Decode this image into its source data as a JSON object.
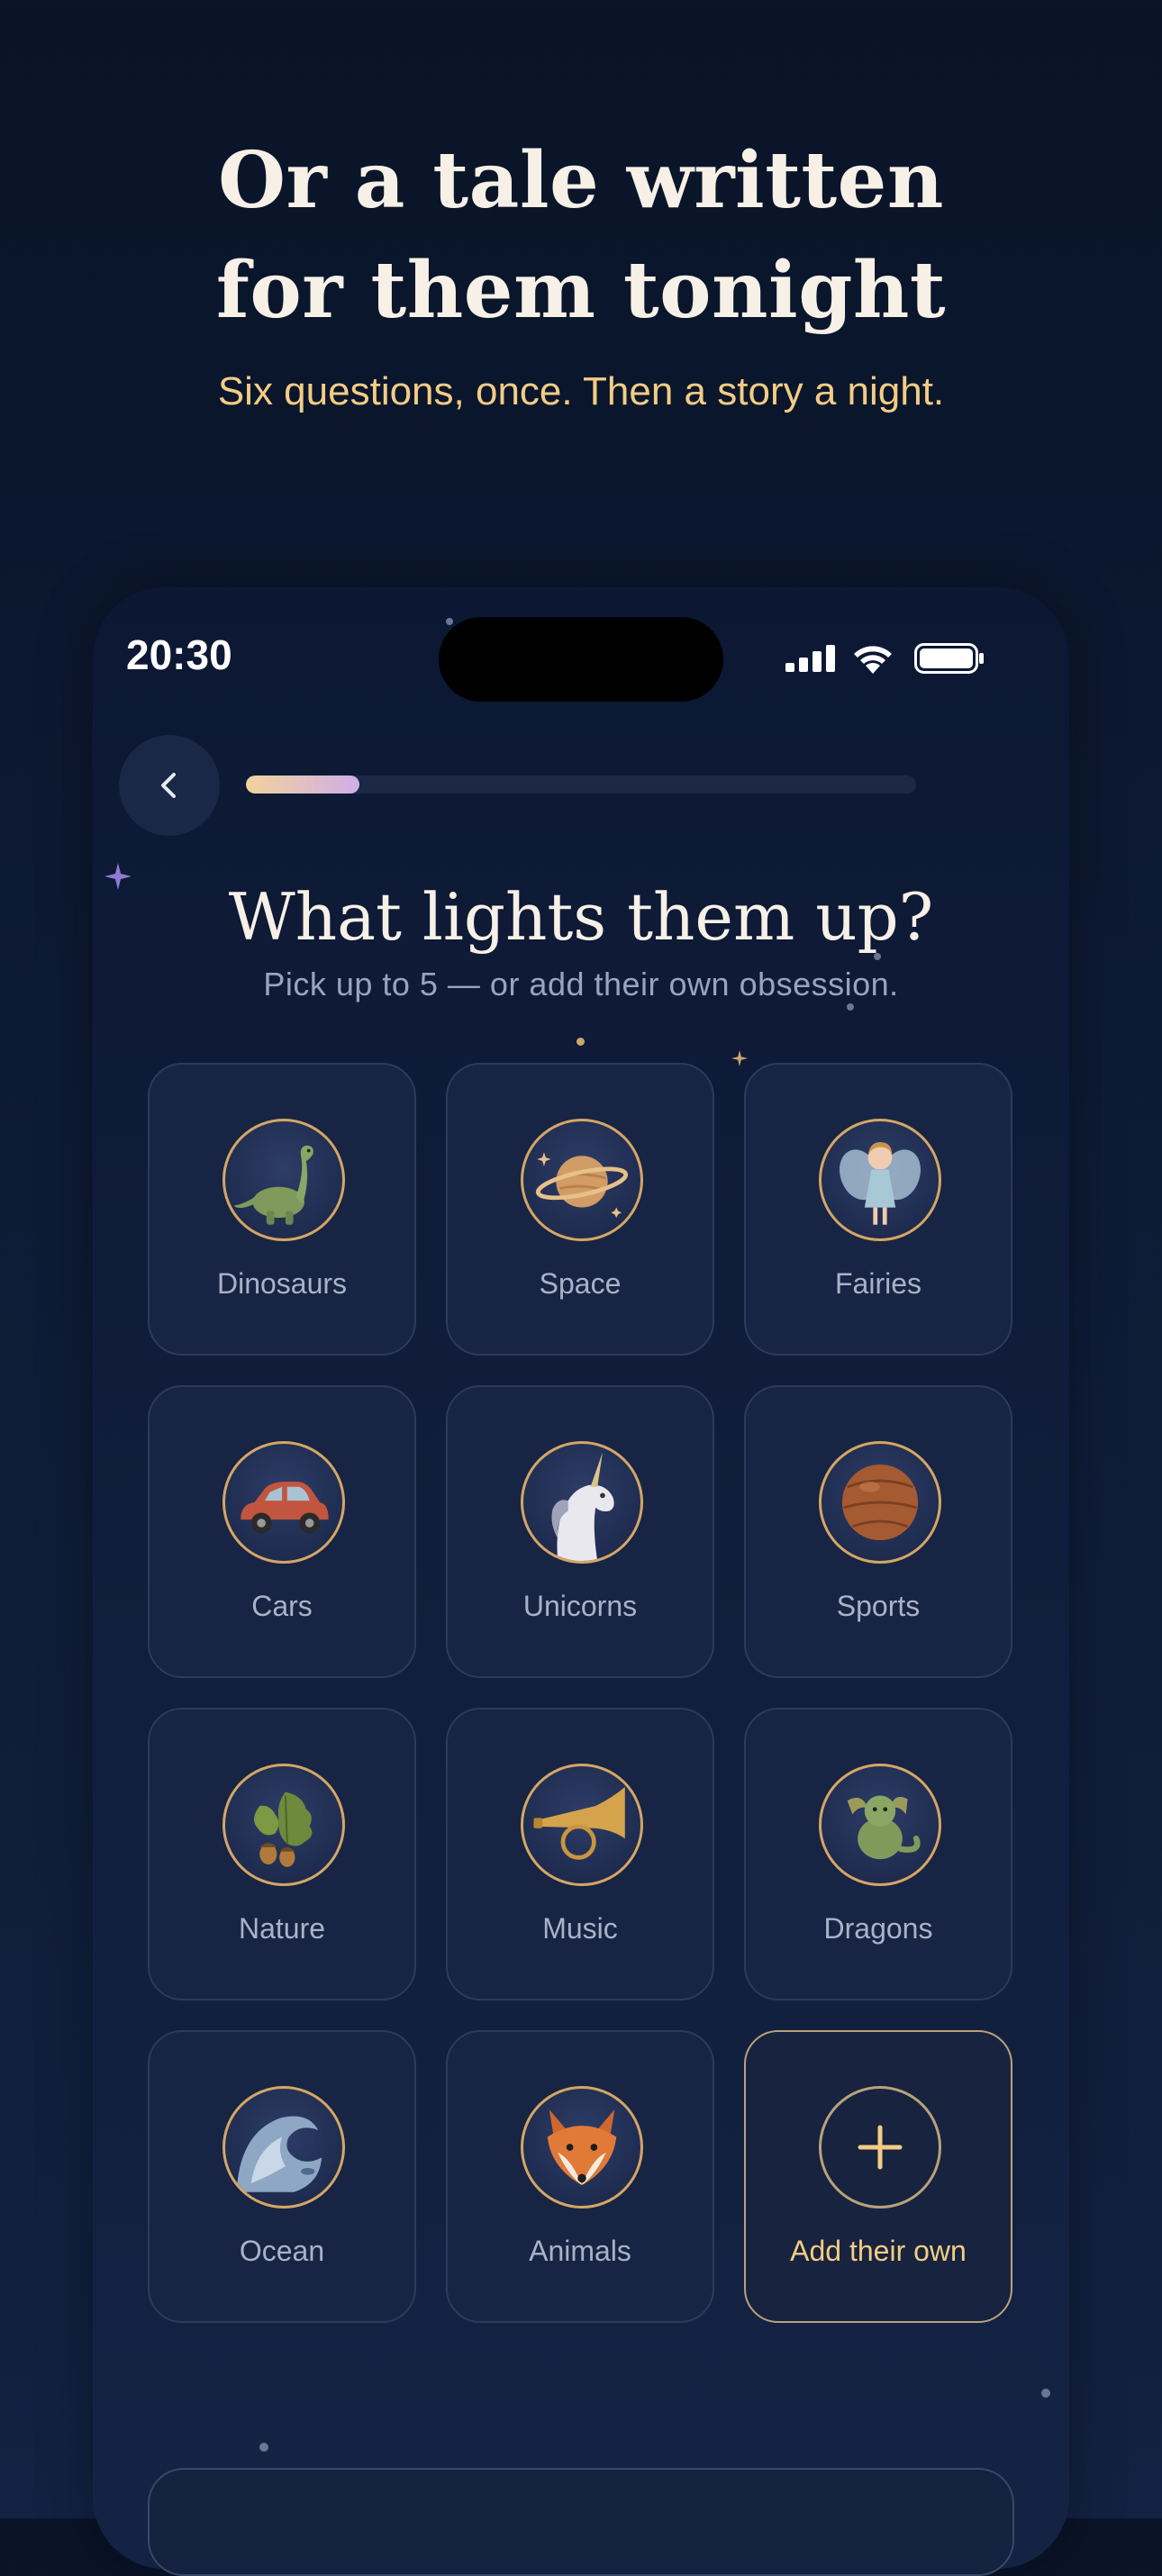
{
  "hero": {
    "title_line1": "Or a tale written",
    "title_line2": "for them tonight",
    "subtitle": "Six questions, once. Then a story a night."
  },
  "status_bar": {
    "time": "20:30",
    "icons": [
      "cellular-signal-icon",
      "wifi-icon",
      "battery-icon"
    ]
  },
  "nav": {
    "back_icon": "chevron-left-icon",
    "progress": 0.17
  },
  "question": {
    "title": "What lights them up?",
    "subtitle": "Pick up to 5 — or add their own obsession."
  },
  "interests": [
    {
      "label": "Dinosaurs",
      "icon": "dinosaur-icon"
    },
    {
      "label": "Space",
      "icon": "planet-icon"
    },
    {
      "label": "Fairies",
      "icon": "fairy-icon"
    },
    {
      "label": "Cars",
      "icon": "car-icon"
    },
    {
      "label": "Unicorns",
      "icon": "unicorn-icon"
    },
    {
      "label": "Sports",
      "icon": "ball-icon"
    },
    {
      "label": "Nature",
      "icon": "oak-leaf-icon"
    },
    {
      "label": "Music",
      "icon": "horn-icon"
    },
    {
      "label": "Dragons",
      "icon": "dragon-icon"
    },
    {
      "label": "Ocean",
      "icon": "wave-icon"
    },
    {
      "label": "Animals",
      "icon": "fox-icon"
    }
  ],
  "add_own": {
    "label": "Add their own",
    "icon": "plus-icon"
  },
  "colors": {
    "background": "#0d1a33",
    "accent_gold": "#f3cc84",
    "title_cream": "#f7f0e6",
    "tile_bg": "#172443",
    "progress_start": "#f2d39a",
    "progress_end": "#cfaee8"
  }
}
